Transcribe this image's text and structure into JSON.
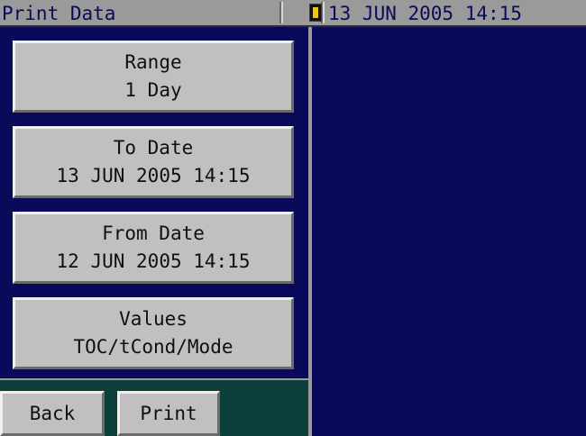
{
  "header": {
    "title": "Print Data",
    "datetime": "13 JUN 2005 14:15",
    "status_icon": "warning-indicator-icon",
    "status_icon_color": "#f0c800"
  },
  "menu": {
    "range": {
      "label": "Range",
      "value": "1 Day"
    },
    "to_date": {
      "label": "To Date",
      "value": "13 JUN 2005 14:15"
    },
    "from_date": {
      "label": "From Date",
      "value": "12 JUN 2005 14:15"
    },
    "values": {
      "label": "Values",
      "value": "TOC/tCond/Mode"
    }
  },
  "footer": {
    "back_label": "Back",
    "print_label": "Print"
  },
  "colors": {
    "background": "#0a0a5a",
    "button": "#c0c0c0",
    "footer_bg": "#0c3f3a",
    "titlebar": "#9a9a9a"
  }
}
